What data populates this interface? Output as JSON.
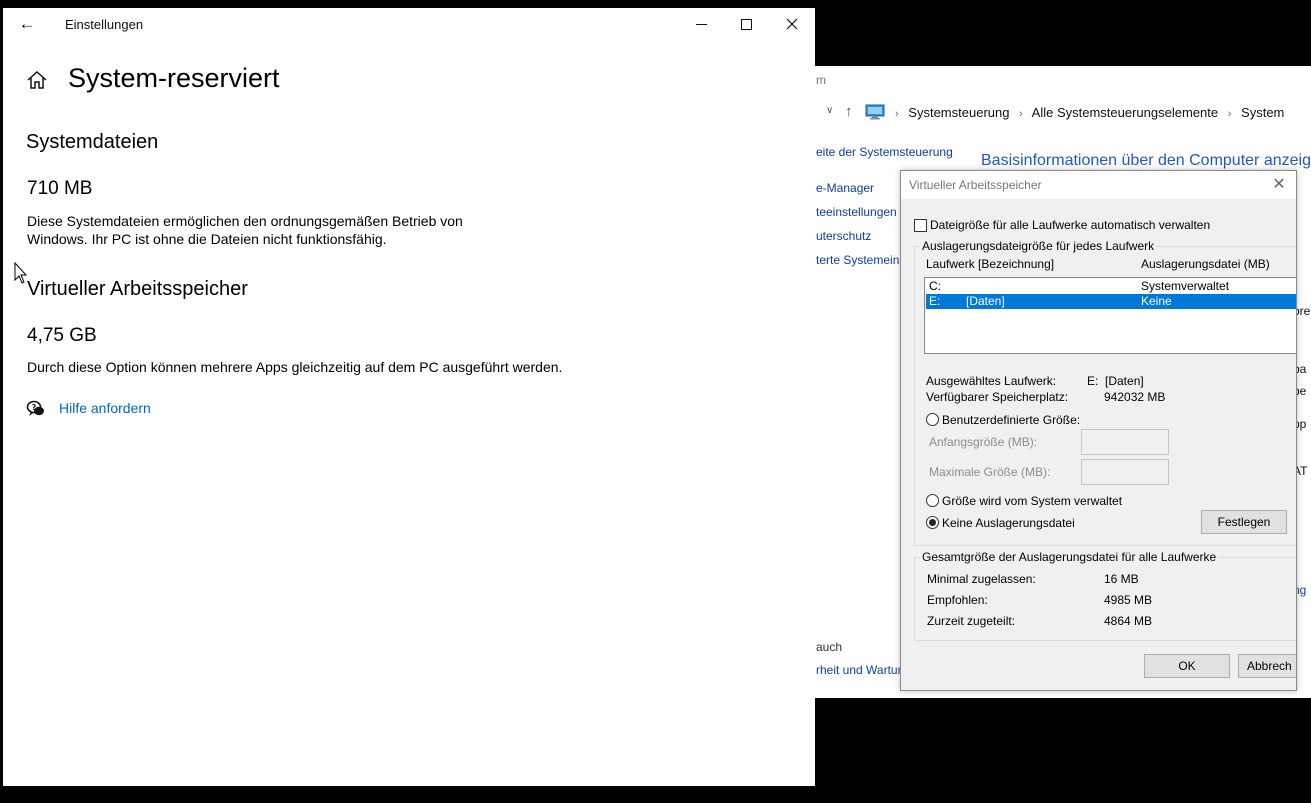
{
  "settings": {
    "app_title": "Einstellungen",
    "page_title": "System-reserviert",
    "system_files": {
      "heading": "Systemdateien",
      "size": "710 MB",
      "description_line1": "Diese Systemdateien ermöglichen den ordnungsgemäßen Betrieb von",
      "description_line2": "Windows. Ihr PC ist ohne die Dateien nicht funktionsfähig."
    },
    "virtual_memory": {
      "heading": "Virtueller Arbeitsspeicher",
      "size": "4,75 GB",
      "description": "Durch diese Option können mehrere Apps gleichzeitig auf dem PC ausgeführt werden."
    },
    "help_link": "Hilfe anfordern"
  },
  "control_panel": {
    "title_fragment": "m",
    "breadcrumb": [
      "Systemsteuerung",
      "Alle Systemsteuerungselemente",
      "System"
    ],
    "sidebar_links": [
      "eite der Systemsteuerung",
      "e-Manager",
      "teeinstellungen",
      "uterschutz",
      "terte Systemeins"
    ],
    "main_title": "Basisinformationen über den Computer anzeige",
    "right_fragments": [
      "ore",
      "ba",
      "be",
      "pp",
      "AT",
      "ng"
    ],
    "see_also": "auch",
    "bottom_link": "rheit und Wartung"
  },
  "vm_dialog": {
    "title": "Virtueller Arbeitsspeicher",
    "auto_manage_label": "Dateigröße für alle Laufwerke automatisch verwalten",
    "auto_manage_checked": false,
    "per_drive_group": "Auslagerungsdateigröße für jedes Laufwerk",
    "columns": [
      "Laufwerk [Bezeichnung]",
      "Auslagerungsdatei (MB)"
    ],
    "drives": [
      {
        "drive": "C:",
        "label": "",
        "paging": "Systemverwaltet",
        "selected": false
      },
      {
        "drive": "E:",
        "label": "[Daten]",
        "paging": "Keine",
        "selected": true
      }
    ],
    "selected_drive_label": "Ausgewähltes Laufwerk:",
    "selected_drive_value": "E:  [Daten]",
    "free_space_label": "Verfügbarer Speicherplatz:",
    "free_space_value": "942032 MB",
    "custom_size_label": "Benutzerdefinierte Größe:",
    "initial_size_label": "Anfangsgröße (MB):",
    "max_size_label": "Maximale Größe (MB):",
    "system_managed_label": "Größe wird vom System verwaltet",
    "no_paging_label": "Keine Auslagerungsdatei",
    "selected_option": "no_paging",
    "set_button": "Festlegen",
    "total_group": "Gesamtgröße der Auslagerungsdatei für alle Laufwerke",
    "min_allowed_label": "Minimal zugelassen:",
    "min_allowed_value": "16 MB",
    "recommended_label": "Empfohlen:",
    "recommended_value": "4985 MB",
    "allocated_label": "Zurzeit zugeteilt:",
    "allocated_value": "4864 MB",
    "ok_button": "OK",
    "cancel_button": "Abbrech"
  }
}
